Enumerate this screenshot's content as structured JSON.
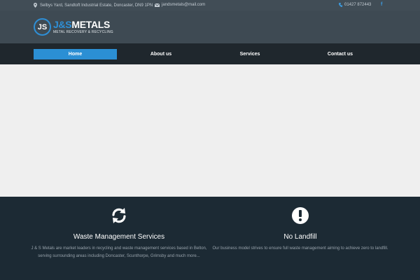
{
  "topbar": {
    "address": "Selbys Yard, Sandtoft Industrial Estate, Doncaster, DN9 1PN",
    "email": "jandsmetals@mail.com",
    "phone": "01427 872443",
    "social": "f"
  },
  "logo": {
    "mark": "JS",
    "title_a": "J&S",
    "title_b": "METALS",
    "subtitle": "METAL RECOVERY & RECYCLING"
  },
  "nav": {
    "items": [
      {
        "label": "Home",
        "active": true
      },
      {
        "label": "About us",
        "active": false
      },
      {
        "label": "Services",
        "active": false
      },
      {
        "label": "Contact us",
        "active": false
      }
    ]
  },
  "services": [
    {
      "icon": "refresh-icon",
      "title": "Waste Management Services",
      "text": "J & S Metals are market leaders in recycling and waste management services based in Belton, serving surrounding areas including Doncaster, Scunthorpe, Grimsby and much more..."
    },
    {
      "icon": "exclamation-icon",
      "title": "No Landfill",
      "text": "Our business model strives to ensure full waste management aiming to achieve zero to landfill."
    }
  ],
  "colors": {
    "accent": "#2b8fd4",
    "topbar": "#414d56",
    "header": "#3e4a53",
    "nav": "#1f272d",
    "hero": "#efefef",
    "services_bg": "#1c2a34"
  }
}
